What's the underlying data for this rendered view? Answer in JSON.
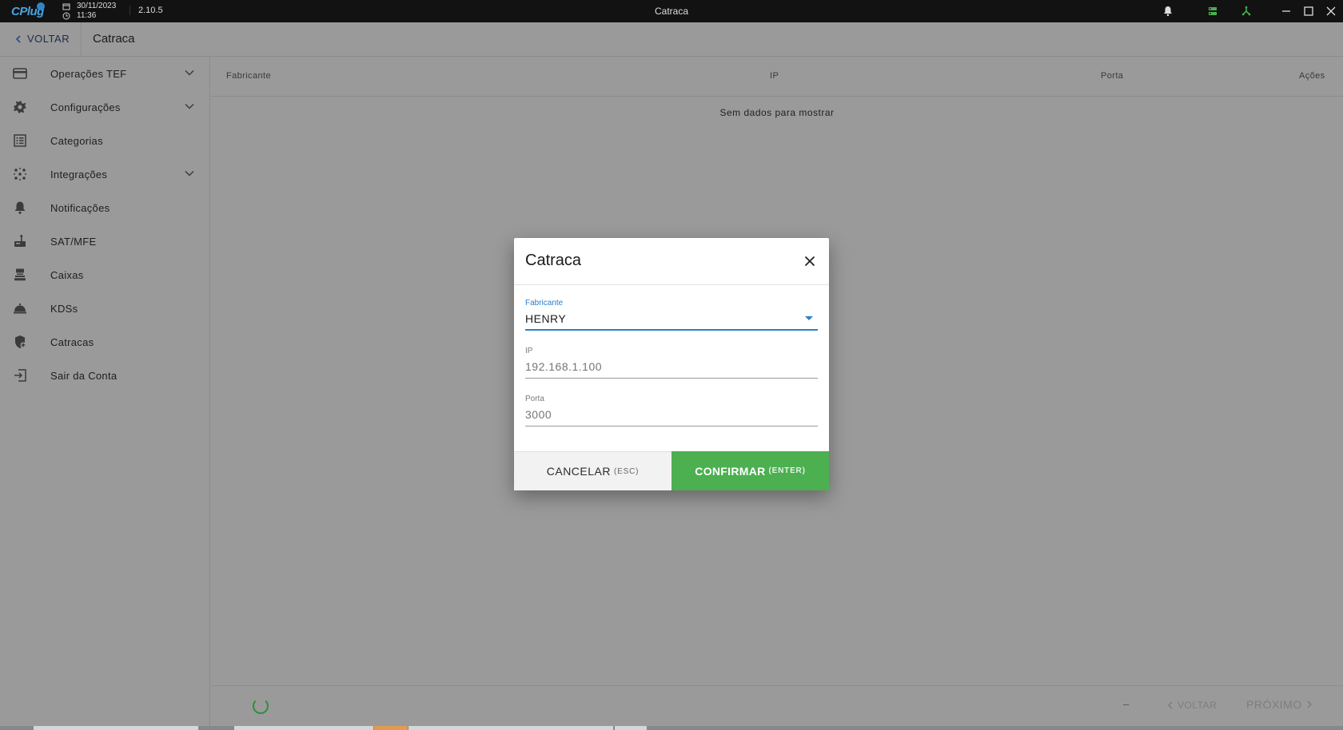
{
  "titlebar": {
    "logo_text": "CPlug",
    "date": "30/11/2023",
    "time": "11:36",
    "version": "2.10.5",
    "window_title": "Catraca",
    "status_color": "#4caf50"
  },
  "subheader": {
    "back_label": "VOLTAR",
    "title": "Catraca"
  },
  "sidebar": {
    "items": [
      {
        "label": "Operações TEF",
        "icon": "credit-card-icon",
        "expandable": true
      },
      {
        "label": "Configurações",
        "icon": "gear-icon",
        "expandable": true
      },
      {
        "label": "Categorias",
        "icon": "list-icon",
        "expandable": false
      },
      {
        "label": "Integrações",
        "icon": "integrations-icon",
        "expandable": true
      },
      {
        "label": "Notificações",
        "icon": "bell-icon",
        "expandable": false
      },
      {
        "label": "SAT/MFE",
        "icon": "sat-device-icon",
        "expandable": false
      },
      {
        "label": "Caixas",
        "icon": "cash-register-icon",
        "expandable": false
      },
      {
        "label": "KDSs",
        "icon": "kds-icon",
        "expandable": false
      },
      {
        "label": "Catracas",
        "icon": "turnstile-icon",
        "expandable": false
      },
      {
        "label": "Sair da Conta",
        "icon": "logout-icon",
        "expandable": false
      }
    ]
  },
  "table": {
    "columns": [
      "Fabricante",
      "IP",
      "Porta",
      "Ações"
    ],
    "empty_text": "Sem dados para mostrar"
  },
  "pagination": {
    "page_indicator": "–",
    "prev_label": "VOLTAR",
    "next_label": "PRÓXIMO"
  },
  "dialog": {
    "title": "Catraca",
    "fields": {
      "fabricante": {
        "label": "Fabricante",
        "value": "HENRY"
      },
      "ip": {
        "label": "IP",
        "placeholder": "192.168.1.100"
      },
      "porta": {
        "label": "Porta",
        "placeholder": "3000"
      }
    },
    "cancel_label": "CANCELAR",
    "cancel_hint": "(ESC)",
    "confirm_label": "CONFIRMAR",
    "confirm_hint": "(ENTER)",
    "accent_color": "#2a7fc9",
    "confirm_color": "#4caf50"
  }
}
